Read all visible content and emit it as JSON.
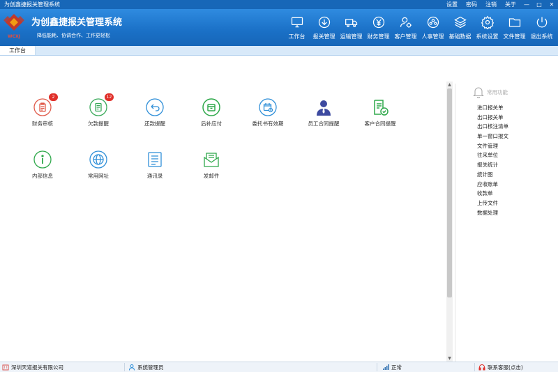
{
  "window": {
    "title": "为创鑫捷报关管理系统"
  },
  "top_menu": {
    "settings": "设置",
    "password": "密码",
    "logout": "注销",
    "about": "关于",
    "minimize": "—",
    "maximize": "□",
    "close": "✕"
  },
  "header": {
    "title": "为创鑫捷报关管理系统",
    "subtitle": "降低能耗、协调合作、工作更轻松",
    "logo_text": "WCXJ"
  },
  "nav": [
    {
      "label": "工作台",
      "icon": "monitor-icon"
    },
    {
      "label": "报关管理",
      "icon": "download-circle-icon"
    },
    {
      "label": "运输管理",
      "icon": "truck-icon"
    },
    {
      "label": "财务管理",
      "icon": "yen-icon"
    },
    {
      "label": "客户管理",
      "icon": "user-gear-icon"
    },
    {
      "label": "人事管理",
      "icon": "people-icon"
    },
    {
      "label": "基础数据",
      "icon": "layers-icon"
    },
    {
      "label": "系统设置",
      "icon": "gear-icon"
    },
    {
      "label": "文件管理",
      "icon": "folder-icon"
    },
    {
      "label": "退出系统",
      "icon": "power-icon"
    }
  ],
  "tabs": [
    {
      "label": "工作台"
    }
  ],
  "functions": [
    {
      "label": "财务审核",
      "icon": "clipboard-icon",
      "color": "#e05a4a",
      "badge": "2"
    },
    {
      "label": "欠款提醒",
      "icon": "document-icon",
      "color": "#3aaa5a",
      "badge": "12"
    },
    {
      "label": "还款提醒",
      "icon": "return-icon",
      "color": "#2f8fd8",
      "badge": ""
    },
    {
      "label": "后补应付",
      "icon": "box-icon",
      "color": "#2ea84a",
      "badge": ""
    },
    {
      "label": "委托书有效期",
      "icon": "calendar-clock-icon",
      "color": "#2f8fd8",
      "badge": ""
    },
    {
      "label": "员工合同提醒",
      "icon": "employee-icon",
      "color": "#3d4aa0",
      "badge": ""
    },
    {
      "label": "客户合同提醒",
      "icon": "contract-check-icon",
      "color": "#2ea84a",
      "badge": ""
    },
    {
      "label": "内部信息",
      "icon": "info-icon",
      "color": "#2ea84a",
      "badge": ""
    },
    {
      "label": "常用网址",
      "icon": "globe-icon",
      "color": "#2f8fd8",
      "badge": ""
    },
    {
      "label": "通讯录",
      "icon": "list-icon",
      "color": "#2f8fd8",
      "badge": ""
    },
    {
      "label": "发邮件",
      "icon": "mail-icon",
      "color": "#2ea84a",
      "badge": ""
    }
  ],
  "side_panel": {
    "title": "常用功能",
    "items": [
      "进口报关单",
      "出口报关单",
      "出口核注清单",
      "单一窗口报文",
      "文件管理",
      "往来单位",
      "报关统计",
      "统计图",
      "应收账单",
      "收款单",
      "上传文件",
      "数据处理"
    ]
  },
  "status_bar": {
    "company": "深圳天道报关有限公司",
    "user": "系统管理员",
    "network": "正常",
    "support": "联系客服(点击)"
  },
  "colors": {
    "header": "#1a70c6",
    "accent": "#2f8fd8"
  }
}
